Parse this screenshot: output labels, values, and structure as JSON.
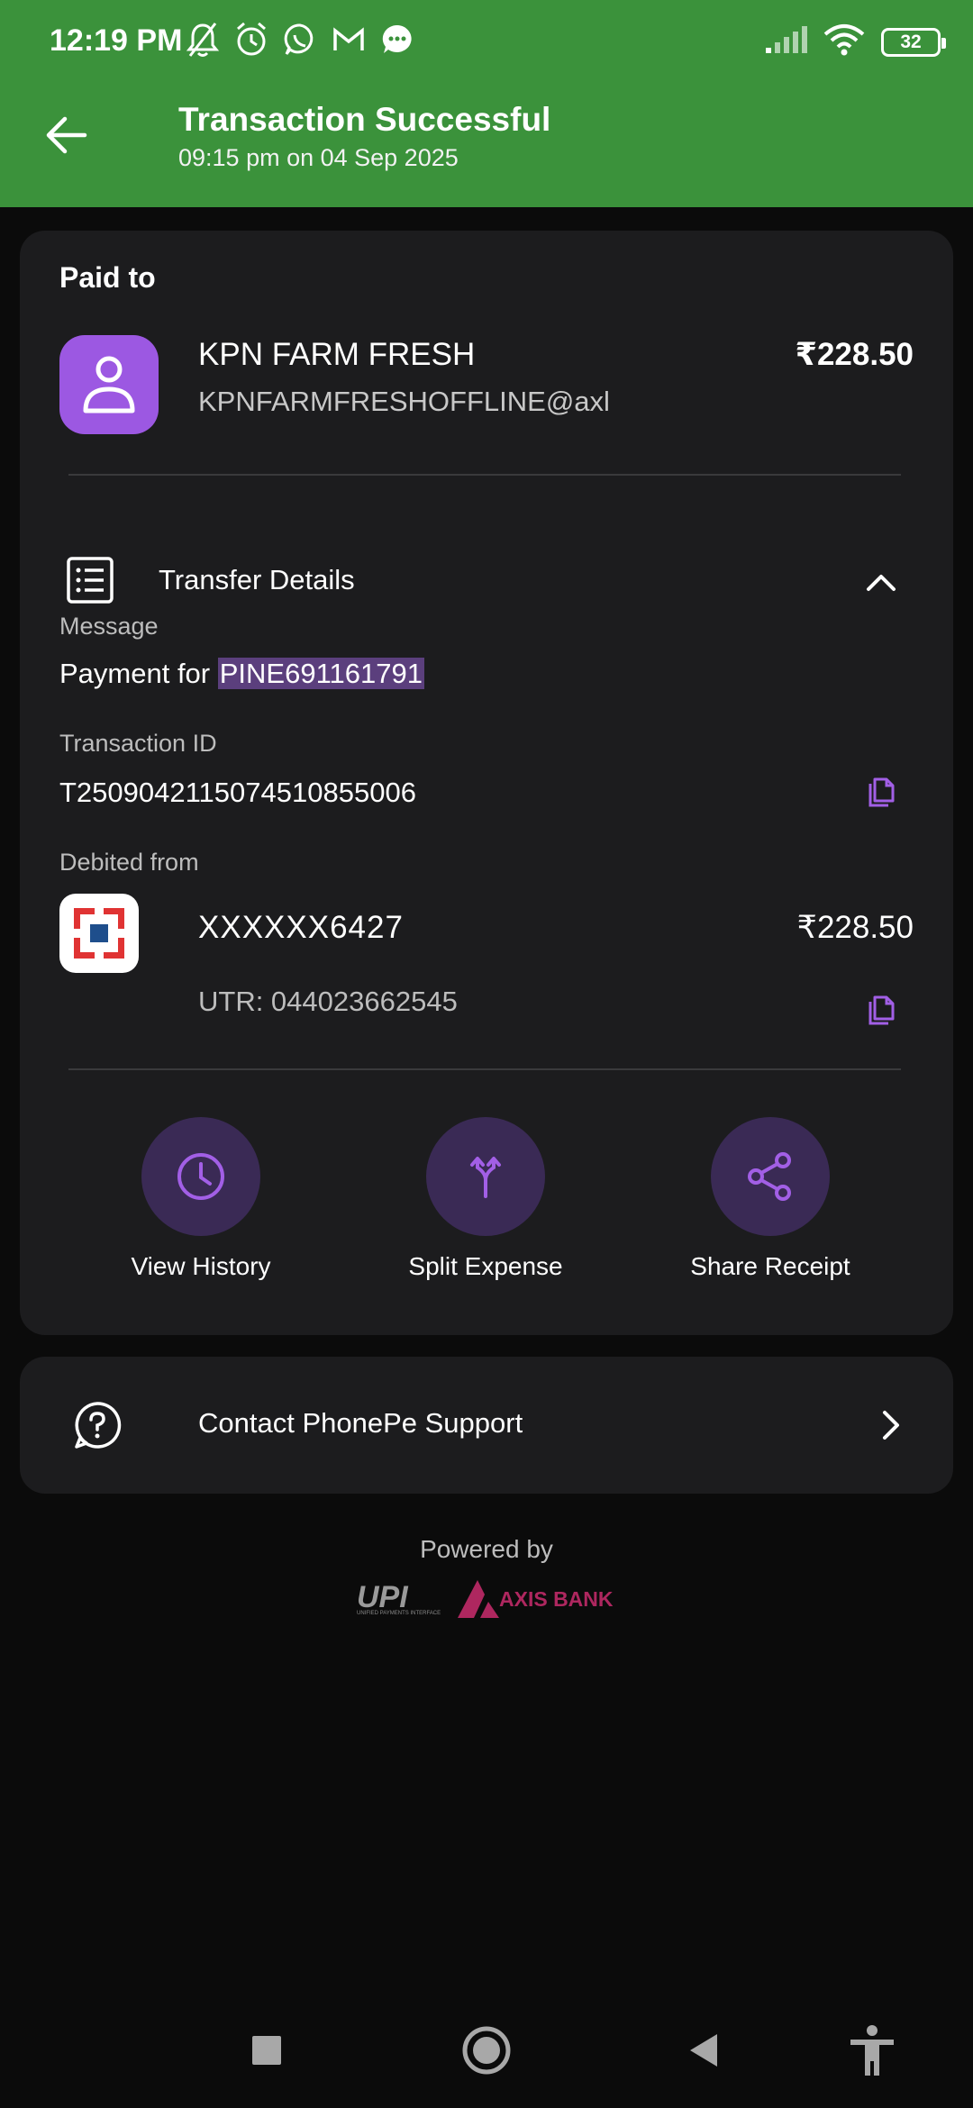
{
  "status_bar": {
    "time": "12:19 PM",
    "battery": "32",
    "left_icons": [
      "muted-bell-icon",
      "alarm-icon",
      "whatsapp-icon",
      "gmail-icon",
      "messages-icon"
    ],
    "right_icons": [
      "signal-icon",
      "wifi-icon",
      "battery-icon"
    ]
  },
  "header": {
    "title": "Transaction Successful",
    "subtitle": "09:15 pm on 04 Sep 2025",
    "background": "#3b923b"
  },
  "paid_to": {
    "label": "Paid to",
    "merchant_name": "KPN FARM FRESH",
    "merchant_vpa": "KPNFARMFRESHOFFLINE@axl",
    "amount": "₹228.50",
    "avatar_color": "#9c58e2"
  },
  "transfer_details": {
    "label": "Transfer Details",
    "message_label": "Message",
    "message_prefix": "Payment for ",
    "message_highlight": "PINE691161791",
    "transaction_id_label": "Transaction ID",
    "transaction_id": "T2509042115074510855006",
    "debited_from_label": "Debited from",
    "account_number": "XXXXXX6427",
    "debit_amount": "₹228.50",
    "utr": "UTR: 044023662545"
  },
  "actions": [
    {
      "label": "View History",
      "icon": "clock-icon"
    },
    {
      "label": "Split Expense",
      "icon": "split-icon"
    },
    {
      "label": "Share Receipt",
      "icon": "share-icon"
    }
  ],
  "support": {
    "label": "Contact PhonePe Support"
  },
  "footer": {
    "powered_by": "Powered by",
    "upi_logo_text": "UPI",
    "upi_tagline": "UNIFIED PAYMENTS INTERFACE",
    "bank_name": "AXIS BANK"
  },
  "colors": {
    "accent_purple": "#a25fe6",
    "card_bg": "#1c1c1e",
    "page_bg": "#0b0b0b"
  }
}
